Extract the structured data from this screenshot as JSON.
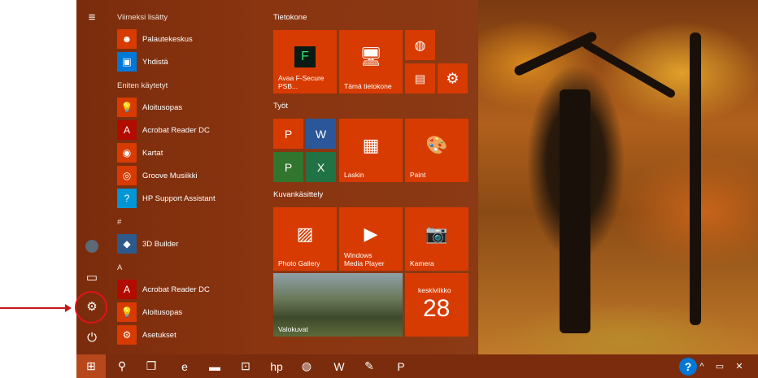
{
  "start_menu": {
    "recent": {
      "header": "Viimeksi lisätty",
      "items": [
        {
          "label": "Palautekeskus",
          "icon": "feedback-hub-icon"
        },
        {
          "label": "Yhdistä",
          "icon": "connect-icon"
        }
      ]
    },
    "most_used": {
      "header": "Eniten käytetyt",
      "items": [
        {
          "label": "Aloitusopas",
          "icon": "get-started-icon"
        },
        {
          "label": "Acrobat Reader DC",
          "icon": "acrobat-icon"
        },
        {
          "label": "Kartat",
          "icon": "maps-icon"
        },
        {
          "label": "Groove Musiikki",
          "icon": "groove-music-icon"
        },
        {
          "label": "HP Support Assistant",
          "icon": "hp-support-icon"
        }
      ]
    },
    "hash_group": {
      "header": "#",
      "items": [
        {
          "label": "3D Builder",
          "icon": "3d-builder-icon"
        }
      ]
    },
    "a_group": {
      "header": "A",
      "items": [
        {
          "label": "Acrobat Reader DC",
          "icon": "acrobat-icon"
        },
        {
          "label": "Aloitusopas",
          "icon": "get-started-icon"
        },
        {
          "label": "Asetukset",
          "icon": "settings-icon"
        }
      ]
    }
  },
  "tiles": {
    "tietokone": {
      "header": "Tietokone",
      "fsecure": "Avaa F-Secure PSB...",
      "this_pc": "Tämä tietokone"
    },
    "tyot": {
      "header": "Työt",
      "laskin": "Laskin",
      "paint": "Paint"
    },
    "kuvankasittely": {
      "header": "Kuvankäsittely",
      "photo_gallery": "Photo Gallery",
      "media_player_1": "Windows",
      "media_player_2": "Media Player",
      "kamera": "Kamera",
      "valokuvat": "Valokuvat",
      "calendar_day": "keskiviikko",
      "calendar_date": "28"
    }
  },
  "colors": {
    "accent": "#d83b01",
    "menu_bg": "#8a3410",
    "highlight": "#e0131a"
  }
}
